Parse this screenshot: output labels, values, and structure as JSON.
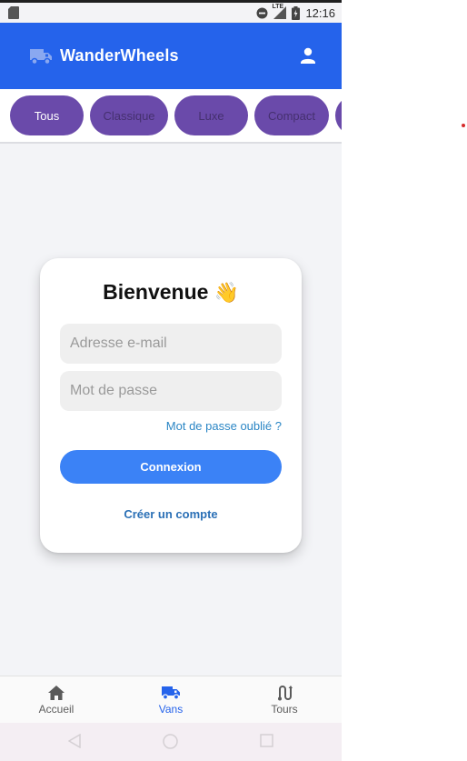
{
  "status_bar": {
    "time": "12:16",
    "network": "LTE"
  },
  "app_bar": {
    "title": "WanderWheels",
    "logo_icon": "van-icon",
    "user_icon": "user-icon",
    "color": "#2563eb"
  },
  "filters": {
    "chips": [
      {
        "label": "Tous",
        "selected": true
      },
      {
        "label": "Classique",
        "selected": false
      },
      {
        "label": "Luxe",
        "selected": false
      },
      {
        "label": "Compact",
        "selected": false
      },
      {
        "label": "",
        "selected": false
      }
    ],
    "chip_color": "#6a4aaa"
  },
  "login_card": {
    "title": "Bienvenue",
    "title_emoji": "👋",
    "email_placeholder": "Adresse e-mail",
    "password_placeholder": "Mot de passe",
    "forgot_label": "Mot de passe oublié ?",
    "login_label": "Connexion",
    "register_label": "Créer un compte",
    "button_color": "#3b82f6"
  },
  "bottom_nav": {
    "items": [
      {
        "label": "Accueil",
        "icon": "home-icon",
        "active": false
      },
      {
        "label": "Vans",
        "icon": "van-icon",
        "active": true
      },
      {
        "label": "Tours",
        "icon": "route-icon",
        "active": false
      }
    ],
    "active_color": "#2563eb"
  }
}
